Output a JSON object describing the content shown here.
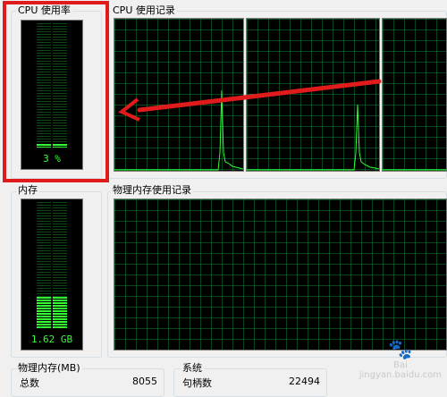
{
  "cpu_usage": {
    "label": "CPU 使用率",
    "value_text": "3 %",
    "level": 0.03
  },
  "cpu_history": {
    "label": "CPU 使用记录",
    "panels": 3
  },
  "memory": {
    "label": "内存",
    "value_text": "1.62 GB",
    "level": 0.25
  },
  "memory_history": {
    "label": "物理内存使用记录"
  },
  "physical_memory": {
    "label": "物理内存(MB)",
    "total_label": "总数",
    "total_value": "8055"
  },
  "system": {
    "label": "系统",
    "handles_label": "句柄数",
    "handles_value": "22494"
  },
  "watermark": {
    "line1": "Bai",
    "line2": "jingyan.baidu.com"
  },
  "colors": {
    "grid": "#0a8c3a",
    "trace": "#33ff33",
    "annotation": "#e01b1b"
  }
}
